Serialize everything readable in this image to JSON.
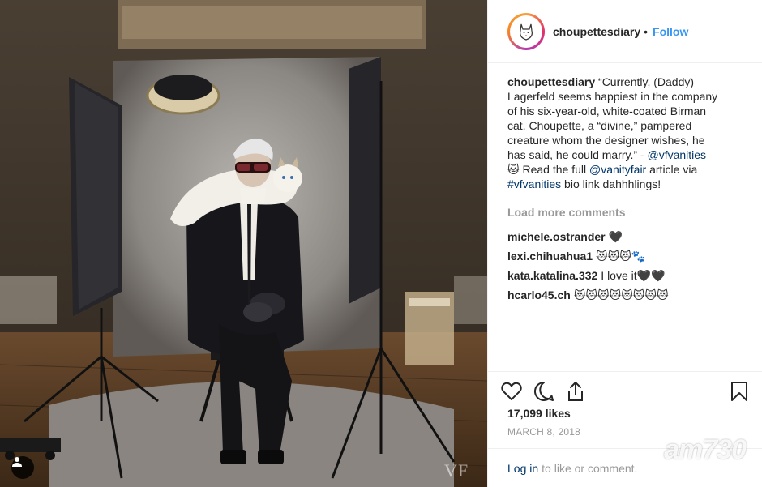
{
  "post": {
    "author": "choupettesdiary",
    "follow_label": "Follow",
    "separator": "•",
    "caption": {
      "user": "choupettesdiary",
      "text_1": "“Currently, (Daddy) Lagerfeld seems happiest in the company of his six-year-old, white-coated Birman cat, Choupette, a “divine,” pampered creature whom the designer wishes, he has said, he could marry.” - ",
      "mention_1": "@vfvanities",
      "text_2": " 🐱 Read the full ",
      "mention_2": "@vanityfair",
      "text_3": " article via ",
      "hashtag": "#vfvanities",
      "text_4": " bio link dahhhlings!"
    },
    "load_more_label": "Load more comments",
    "comments": [
      {
        "user": "michele.ostrander",
        "text": "🖤"
      },
      {
        "user": "lexi.chihuahua1",
        "text": "😻😻😻🐾"
      },
      {
        "user": "kata.katalina.332",
        "text": "I love it🖤🖤"
      },
      {
        "user": "hcarlo45.ch",
        "text": "😻😻😻😻😻😻😻😻"
      }
    ],
    "likes": "17,099 likes",
    "date": "MARCH 8, 2018",
    "login_link": "Log in",
    "login_text": "to like or comment."
  },
  "photo": {
    "magazine_watermark": "VF",
    "site_watermark": "am730"
  },
  "icons": {
    "like": "heart-outline-icon",
    "comment": "speech-bubble-icon",
    "share": "share-upload-icon",
    "save": "bookmark-icon",
    "tag": "user-tag-icon"
  },
  "colors": {
    "link_blue": "#3897f0",
    "mention": "#003569",
    "muted": "#999999",
    "text": "#262626"
  }
}
